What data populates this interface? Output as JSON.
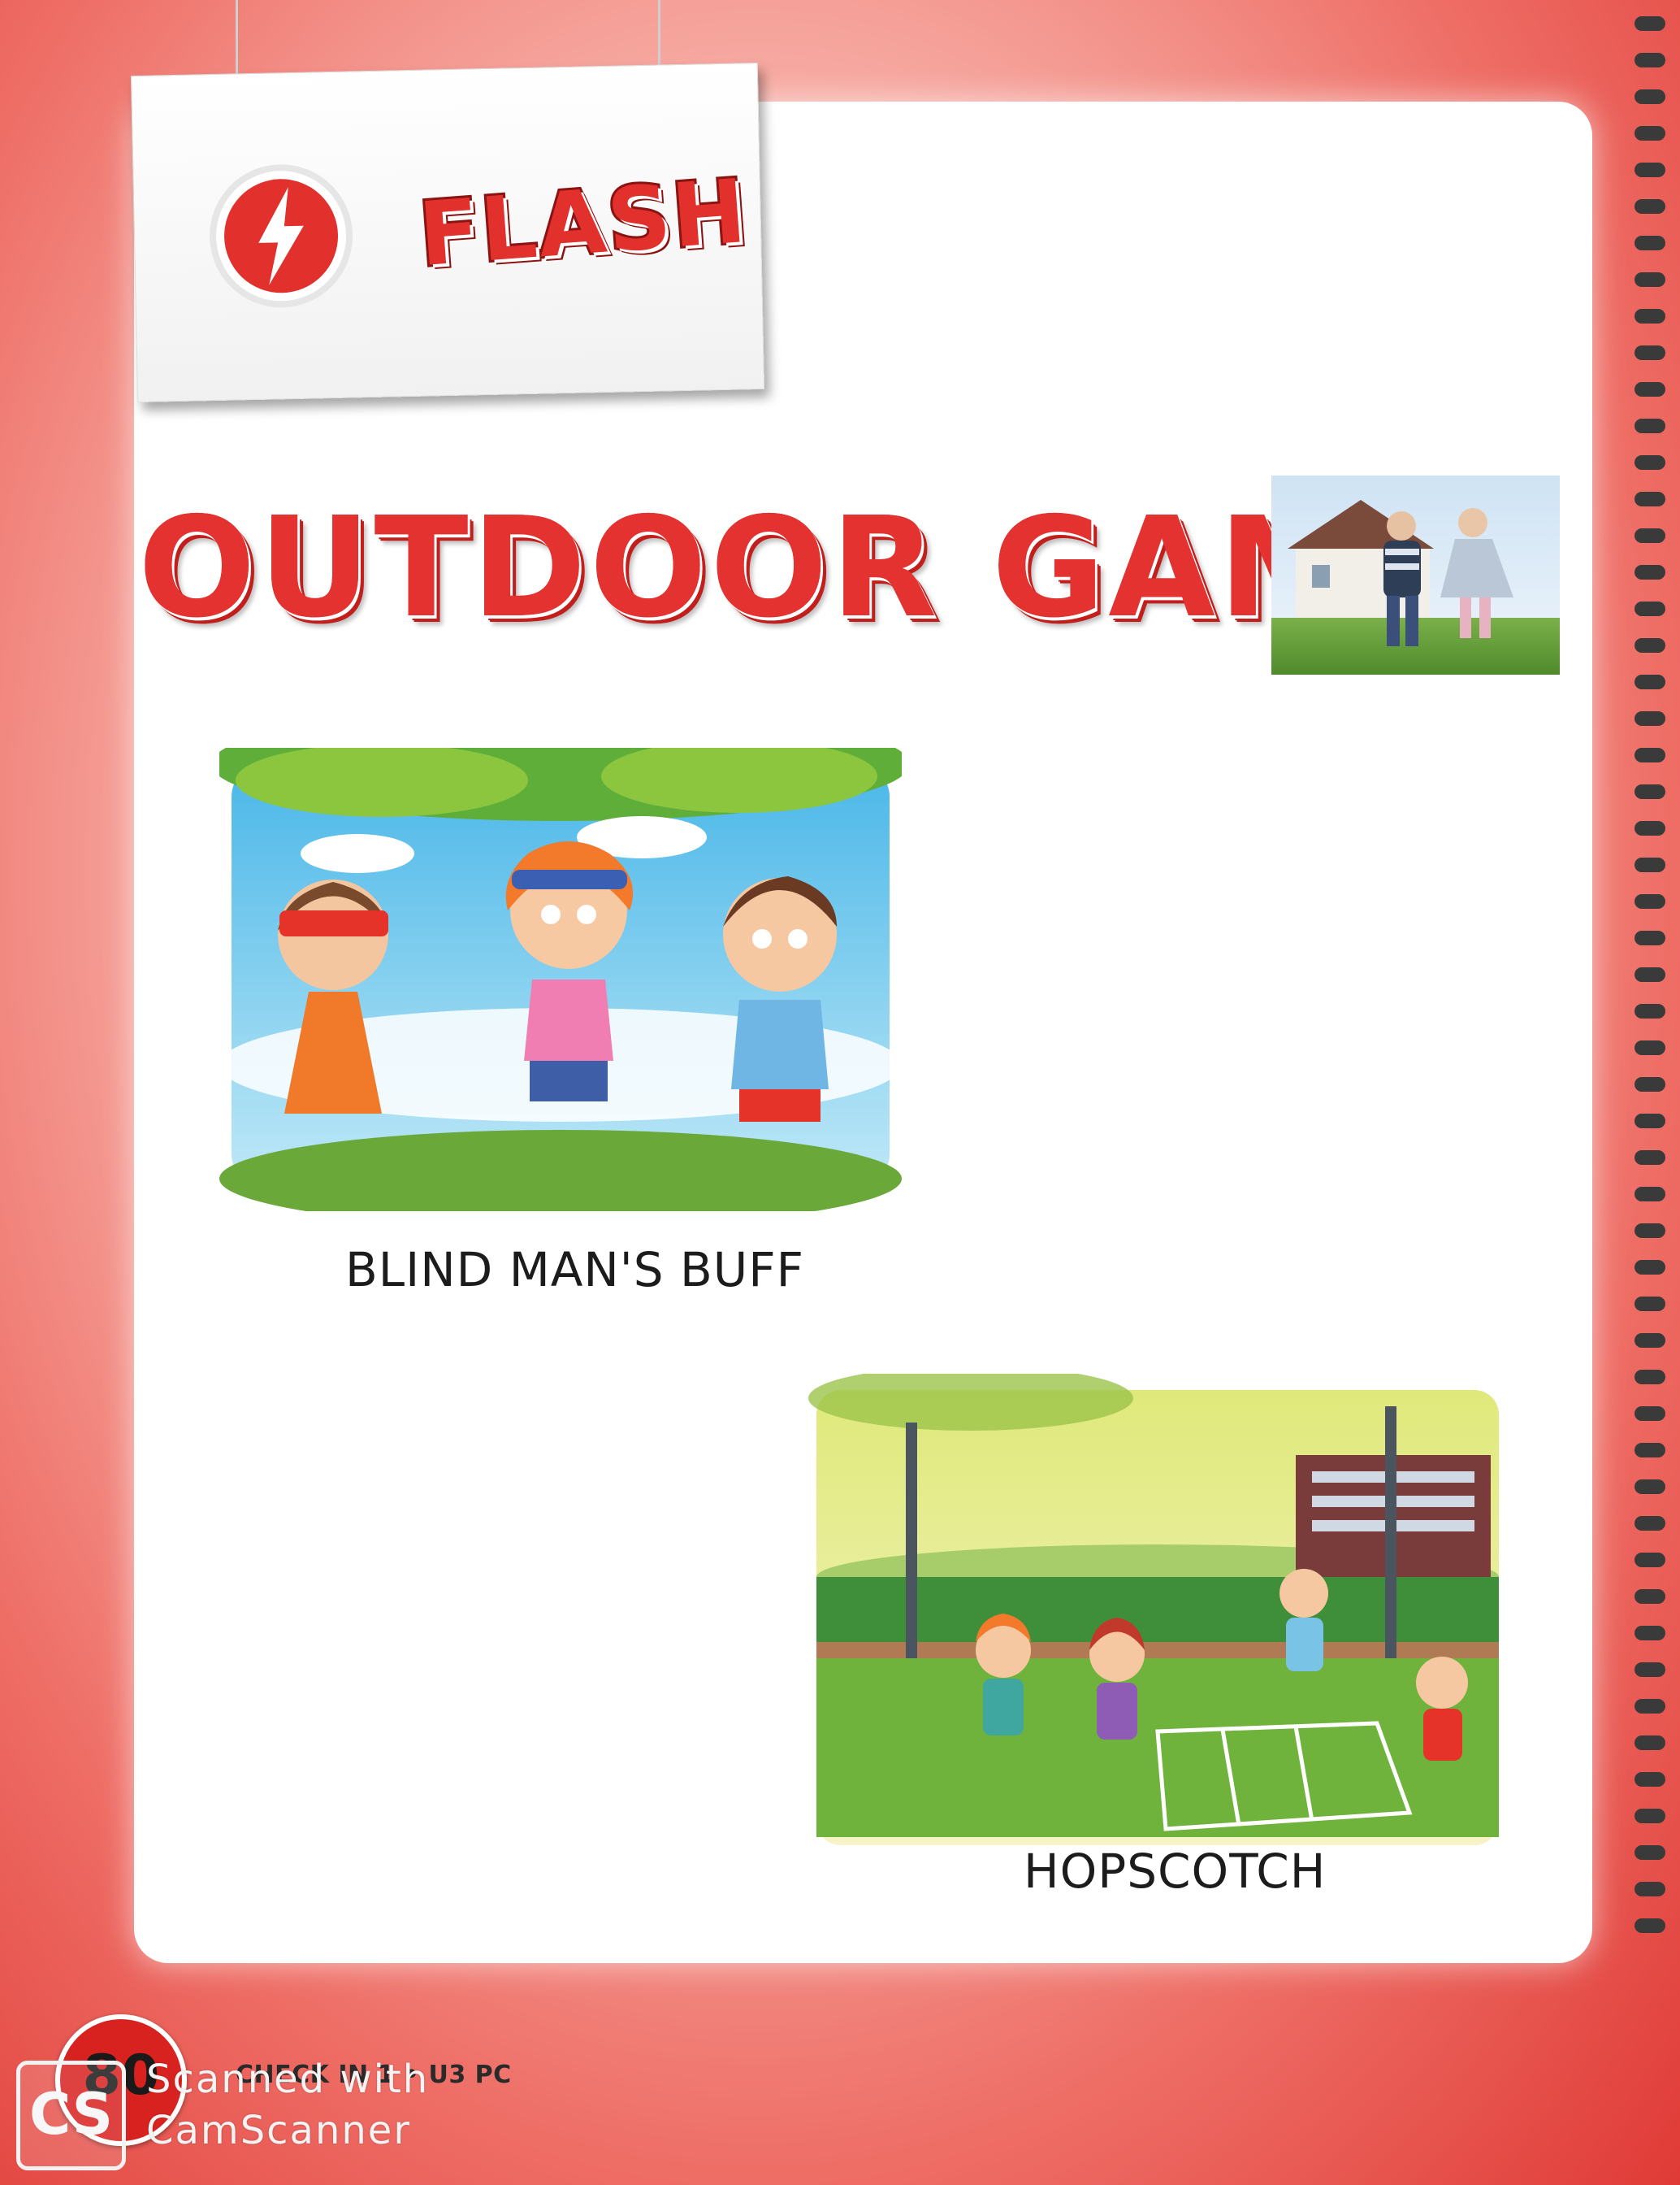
{
  "header": {
    "badge_icon": "lightning-bolt-icon",
    "badge_label": "FLASH"
  },
  "title": "OUTDOOR GAMES",
  "photo": {
    "subject": "children-running-photo"
  },
  "games": [
    {
      "caption": "BLIND MAN'S BUFF",
      "illustration": "children-blindfold-illustration"
    },
    {
      "caption": "HOPSCOTCH",
      "illustration": "children-hopscotch-illustration"
    }
  ],
  "footer": {
    "page_number": "80",
    "book_label": "CHECK IN 1 • U3 PC"
  },
  "watermark": {
    "logo": "CS",
    "line1": "Scanned with",
    "line2": "CamScanner"
  },
  "colors": {
    "accent_red": "#e3322f",
    "panel": "#ffffff",
    "caption_text": "#1c1c1c"
  }
}
